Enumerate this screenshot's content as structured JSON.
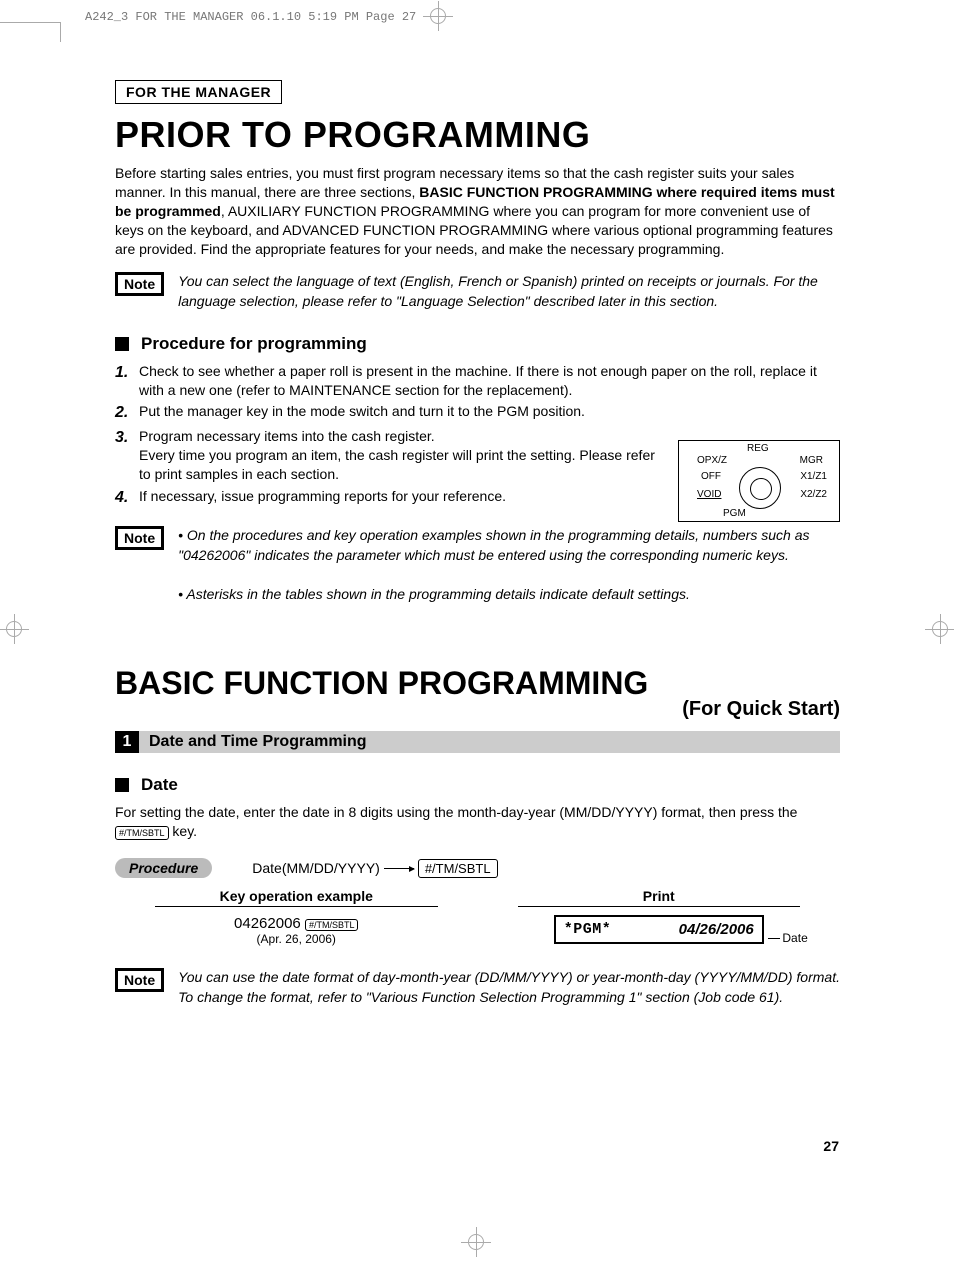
{
  "crop_header": "A242_3 FOR THE MANAGER  06.1.10 5:19 PM  Page 27",
  "section_header": "FOR THE MANAGER",
  "title1": "PRIOR TO PROGRAMMING",
  "intro": {
    "p1a": "Before starting sales entries, you must first program necessary items so that the cash register suits your sales manner.  In this manual, there are three sections, ",
    "p1b": "BASIC FUNCTION PROGRAMMING where required items must be programmed",
    "p1c": ", AUXILIARY FUNCTION PROGRAMMING where you can program for more convenient use of keys on the keyboard, and ADVANCED FUNCTION PROGRAMMING where various optional programming features are provided.  Find the appropriate features for your needs, and make the necessary programming."
  },
  "note_label": "Note",
  "note1": "You can select the language of text (English, French or Spanish) printed on receipts or journals. For the language selection, please refer to \"Language Selection\" described later in this section.",
  "sub1": "Procedure for programming",
  "steps": [
    "Check to see whether a paper roll is present in the machine.  If there is not enough paper on the roll, replace it with a new one (refer to MAINTENANCE section for the replacement).",
    "Put the manager key in the mode switch and turn it to the PGM position.",
    "Program necessary items into the cash register.\nEvery time you program an item, the cash register will print the setting.  Please refer to print samples in each section.",
    "If necessary, issue programming reports for your reference."
  ],
  "dial": {
    "reg": "REG",
    "opx": "OPX/Z",
    "mgr": "MGR",
    "off": "OFF",
    "x1": "X1/Z1",
    "void": "VOID",
    "x2": "X2/Z2",
    "pgm": "PGM"
  },
  "note2a": "• On the procedures and key operation examples shown in the programming details, numbers such as \"04262006\" indicates the parameter which must be entered using the corresponding numeric keys.",
  "note2b": "• Asterisks in the tables shown in the programming details indicate default settings.",
  "title2": "BASIC FUNCTION PROGRAMMING",
  "title2_sub": "(For Quick Start)",
  "bar1_num": "1",
  "bar1_text": "Date and Time Programming",
  "sub2": "Date",
  "date_para_a": "For setting the date, enter the date in 8 digits using the month-day-year (MM/DD/YYYY) format, then press the ",
  "date_para_b": " key.",
  "key_small": "#/TM/SBTL",
  "procedure_label": "Procedure",
  "proc_input": "Date(MM/DD/YYYY)",
  "proc_key": "#/TM/SBTL",
  "col1_header": "Key operation example",
  "col2_header": "Print",
  "example_digits": "04262006",
  "example_key": "#/TM/SBTL",
  "example_sub": "(Apr. 26, 2006)",
  "print_pgm": "*PGM*",
  "print_date": "04/26/2006",
  "print_date_label": "Date",
  "note3": "You can use the date format of day-month-year (DD/MM/YYYY) or year-month-day (YYYY/MM/DD) format.  To change the format, refer to \"Various Function Selection Programming 1\" section (Job code 61).",
  "page_number": "27"
}
